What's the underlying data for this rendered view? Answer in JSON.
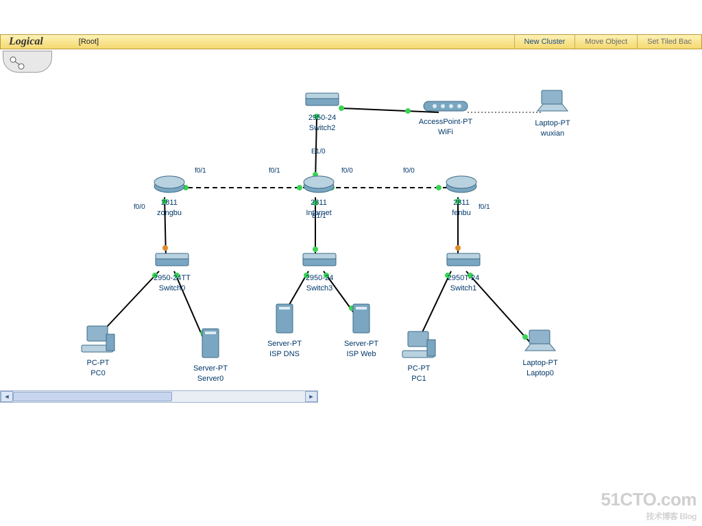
{
  "toolbar": {
    "mode": "Logical",
    "crumb": "[Root]",
    "new_cluster": "New Cluster",
    "move_object": "Move Object",
    "set_bg": "Set Tiled Bac"
  },
  "nodes": {
    "sw2": {
      "model": "2950-24",
      "name": "Switch2"
    },
    "ap": {
      "model": "AccessPoint-PT",
      "name": "WiFi"
    },
    "laptop_wuxian": {
      "model": "Laptop-PT",
      "name": "wuxian"
    },
    "r_zongbu": {
      "model": "2811",
      "name": "zongbu"
    },
    "r_internet": {
      "model": "2811",
      "name": "Internet"
    },
    "r_fenbu": {
      "model": "2811",
      "name": "fenbu"
    },
    "sw0": {
      "model": "2950-24TT",
      "name": "Switch0"
    },
    "sw3": {
      "model": "2950-24",
      "name": "Switch3"
    },
    "sw1": {
      "model": "2950T-24",
      "name": "Switch1"
    },
    "pc0": {
      "model": "PC-PT",
      "name": "PC0"
    },
    "server0": {
      "model": "Server-PT",
      "name": "Server0"
    },
    "dns": {
      "model": "Server-PT",
      "name": "ISP DNS"
    },
    "web": {
      "model": "Server-PT",
      "name": "ISP Web"
    },
    "pc1": {
      "model": "PC-PT",
      "name": "PC1"
    },
    "laptop0": {
      "model": "Laptop-PT",
      "name": "Laptop0"
    }
  },
  "ifaces": {
    "e10": "E1/0",
    "e11": "E1/1",
    "f00a": "f0/0",
    "f00b": "f0/0",
    "f00c": "f0/0",
    "f01a": "f0/1",
    "f01b": "f0/1",
    "f01c": "f0/1"
  },
  "watermark": {
    "big": "51CTO.com",
    "sub": "技术博客   Blog"
  }
}
